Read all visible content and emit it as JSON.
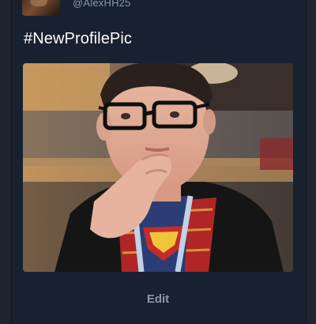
{
  "tweet": {
    "handle": "@AlexHH25",
    "text": "#NewProfilePic",
    "media_alt": "photo"
  },
  "actions": {
    "edit_label": "Edit"
  },
  "colors": {
    "background": "#1d2430",
    "card": "#182130",
    "handle_text": "#8899a6",
    "edit_text": "#8b97a4"
  },
  "icons": [
    "profile-avatar-image",
    "tweet-media-image"
  ]
}
